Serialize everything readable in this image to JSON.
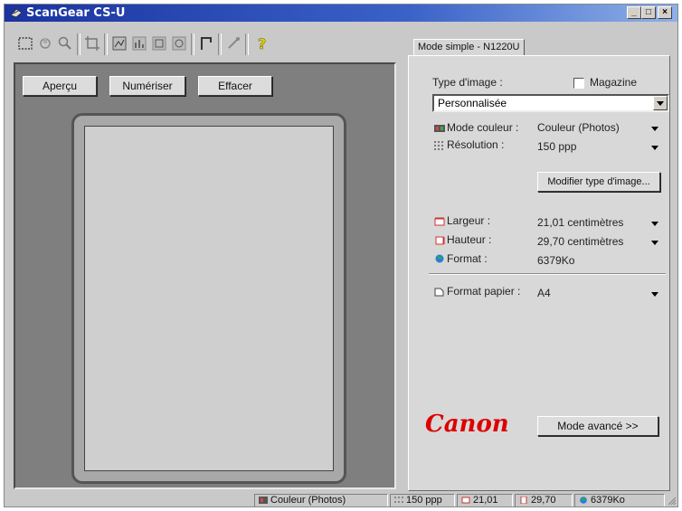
{
  "window": {
    "title": "ScanGear CS-U"
  },
  "left": {
    "preview_button": "Aperçu",
    "scan_button": "Numériser",
    "clear_button": "Effacer"
  },
  "tab": {
    "label": "Mode simple - N1220U"
  },
  "form": {
    "image_type_label": "Type d'image :",
    "magazine_label": "Magazine",
    "image_type_value": "Personnalisée",
    "color_mode_label": "Mode couleur :",
    "color_mode_value": "Couleur (Photos)",
    "resolution_label": "Résolution :",
    "resolution_value": "150 ppp",
    "modify_button": "Modifier type d'image...",
    "width_label": "Largeur :",
    "width_value": "21,01 centimètres",
    "height_label": "Hauteur :",
    "height_value": "29,70 centimètres",
    "format_label": "Format :",
    "format_value": "6379Ko",
    "paper_label": "Format papier :",
    "paper_value": "A4",
    "advanced_button": "Mode avancé >>",
    "brand": "Canon"
  },
  "status": {
    "color_mode": "Couleur (Photos)",
    "resolution": "150 ppp",
    "width": "21,01",
    "height": "29,70",
    "size": "6379Ko"
  },
  "colors": {
    "brand": "#dd0000",
    "titlebar": "#1a33a0"
  }
}
